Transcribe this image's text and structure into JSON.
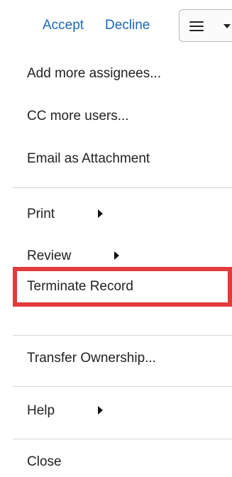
{
  "toolbar": {
    "accept_label": "Accept",
    "decline_label": "Decline",
    "menu_button_icon": "hamburger-icon",
    "menu_caret_icon": "chevron-down-icon"
  },
  "menu": {
    "groups": [
      {
        "items": [
          {
            "label": "Add more assignees..."
          },
          {
            "label": "CC more users..."
          },
          {
            "label": "Email as Attachment"
          }
        ]
      },
      {
        "items": [
          {
            "label": "Print",
            "submenu": true
          },
          {
            "label": "Review",
            "submenu": true
          },
          {
            "label": "Terminate Record",
            "highlighted": true
          }
        ]
      },
      {
        "items": [
          {
            "label": "Transfer Ownership..."
          }
        ]
      },
      {
        "items": [
          {
            "label": "Help",
            "submenu": true
          }
        ]
      },
      {
        "items": [
          {
            "label": "Close"
          }
        ]
      }
    ]
  },
  "colors": {
    "link": "#1a67b8",
    "highlight": "#e23b3b",
    "text": "#222222",
    "separator": "#d6d6d6"
  }
}
